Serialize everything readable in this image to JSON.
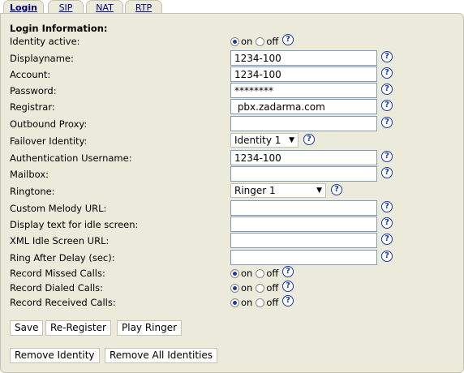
{
  "tabs": [
    {
      "label": "Login",
      "active": true
    },
    {
      "label": "SIP",
      "active": false
    },
    {
      "label": "NAT",
      "active": false
    },
    {
      "label": "RTP",
      "active": false
    }
  ],
  "heading": "Login Information:",
  "help_symbol": "?",
  "radio": {
    "on": "on",
    "off": "off"
  },
  "identity_active": {
    "label": "Identity active:",
    "value": "on"
  },
  "displayname": {
    "label": "Displayname:",
    "value": "1234-100"
  },
  "account": {
    "label": "Account:",
    "value": "1234-100"
  },
  "password": {
    "label": "Password:",
    "value": "********"
  },
  "registrar": {
    "label": "Registrar:",
    "value": " pbx.zadarma.com"
  },
  "outbound_proxy": {
    "label": "Outbound Proxy:",
    "value": ""
  },
  "failover_identity": {
    "label": "Failover Identity:",
    "value": "Identity 1"
  },
  "auth_username": {
    "label": "Authentication Username:",
    "value": "1234-100"
  },
  "mailbox": {
    "label": "Mailbox:",
    "value": ""
  },
  "ringtone": {
    "label": "Ringtone:",
    "value": "Ringer 1"
  },
  "custom_melody_url": {
    "label": "Custom Melody URL:",
    "value": ""
  },
  "idle_text": {
    "label": "Display text for idle screen:",
    "value": ""
  },
  "xml_idle_url": {
    "label": "XML Idle Screen URL:",
    "value": ""
  },
  "ring_after_delay": {
    "label": "Ring After Delay (sec):",
    "value": ""
  },
  "record_missed": {
    "label": "Record Missed Calls:",
    "value": "on"
  },
  "record_dialed": {
    "label": "Record Dialed Calls:",
    "value": "on"
  },
  "record_received": {
    "label": "Record Received Calls:",
    "value": "on"
  },
  "buttons": {
    "save": "Save",
    "reregister": "Re-Register",
    "play_ringer": "Play Ringer",
    "remove_identity": "Remove Identity",
    "remove_all": "Remove All Identities"
  },
  "colors": {
    "panel": "#ebeadb",
    "link": "#00008b",
    "help": "#1a3aa8"
  }
}
